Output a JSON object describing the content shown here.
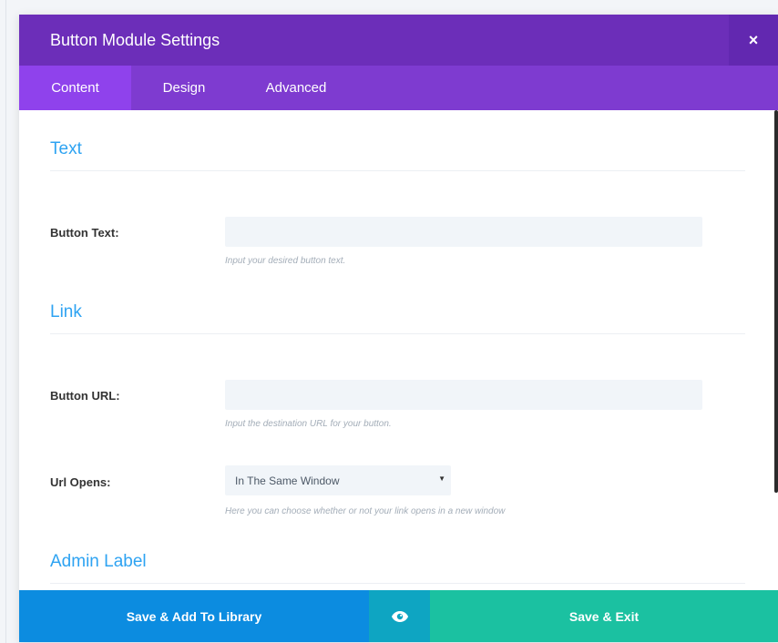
{
  "modal": {
    "title": "Button Module Settings",
    "close_label": "×"
  },
  "tabs": [
    {
      "label": "Content",
      "active": true
    },
    {
      "label": "Design",
      "active": false
    },
    {
      "label": "Advanced",
      "active": false
    }
  ],
  "sections": {
    "text": {
      "title": "Text",
      "button_text": {
        "label": "Button Text:",
        "value": "",
        "help": "Input your desired button text."
      }
    },
    "link": {
      "title": "Link",
      "button_url": {
        "label": "Button URL:",
        "value": "",
        "help": "Input the destination URL for your button."
      },
      "url_opens": {
        "label": "Url Opens:",
        "selected": "In The Same Window",
        "arrow": "▼",
        "help": "Here you can choose whether or not your link opens in a new window"
      }
    },
    "admin_label": {
      "title": "Admin Label"
    }
  },
  "footer": {
    "save_library_label": "Save & Add To Library",
    "preview_icon": "eye-icon",
    "save_exit_label": "Save & Exit"
  },
  "colors": {
    "header": "#6c2eb9",
    "tabs": "#7e3bd0",
    "active_tab": "#8f42ec",
    "section_title": "#2ea3f2",
    "library_button": "#0c8ce0",
    "preview_button": "#0ea5c2",
    "exit_button": "#1bc1a1"
  }
}
